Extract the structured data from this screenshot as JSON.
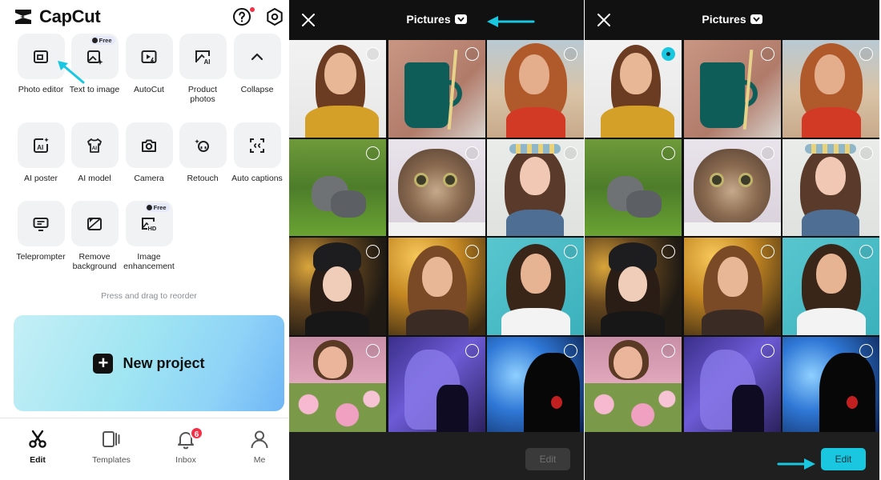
{
  "app": {
    "name": "CapCut"
  },
  "tools": [
    {
      "label": "Photo editor",
      "icon": "photo-editor-icon",
      "free": false
    },
    {
      "label": "Text to image",
      "icon": "text-to-image-icon",
      "free": true
    },
    {
      "label": "AutoCut",
      "icon": "autocut-icon",
      "free": false
    },
    {
      "label": "Product photos",
      "icon": "product-photos-icon",
      "free": false
    },
    {
      "label": "Collapse",
      "icon": "chevron-up-icon",
      "free": false
    },
    {
      "label": "AI poster",
      "icon": "ai-poster-icon",
      "free": false
    },
    {
      "label": "AI model",
      "icon": "ai-model-icon",
      "free": false
    },
    {
      "label": "Camera",
      "icon": "camera-icon",
      "free": false
    },
    {
      "label": "Retouch",
      "icon": "retouch-icon",
      "free": false
    },
    {
      "label": "Auto captions",
      "icon": "auto-captions-icon",
      "free": false
    },
    {
      "label": "Teleprompter",
      "icon": "teleprompter-icon",
      "free": false
    },
    {
      "label": "Remove background",
      "icon": "remove-background-icon",
      "free": false
    },
    {
      "label": "Image enhancement",
      "icon": "image-enhancement-icon",
      "free": true
    }
  ],
  "free_badge": "Free",
  "reorder_hint": "Press and drag to reorder",
  "new_project_label": "New project",
  "nav": [
    {
      "label": "Edit",
      "icon": "scissors-icon",
      "active": true
    },
    {
      "label": "Templates",
      "icon": "templates-icon",
      "active": false
    },
    {
      "label": "Inbox",
      "icon": "bell-icon",
      "active": false,
      "badge": "6"
    },
    {
      "label": "Me",
      "icon": "user-icon",
      "active": false
    }
  ],
  "picker": {
    "title": "Pictures",
    "edit_label": "Edit",
    "photos": [
      "girl-yellow-shirt",
      "green-mug",
      "girl-red-scarf",
      "kitten-grass",
      "tabby-cat",
      "girl-flower-crown",
      "girl-black-beanie",
      "girl-golden-bokeh",
      "girl-teal-background",
      "girl-pink-flowers",
      "anime-purple",
      "anime-blue-sparkles"
    ]
  },
  "picker_states": [
    {
      "selected_index": -1,
      "edit_enabled": false
    },
    {
      "selected_index": 0,
      "edit_enabled": true
    }
  ],
  "colors": {
    "accent": "#19c8e0",
    "badge": "#f23047",
    "picker_bg": "#111111"
  }
}
